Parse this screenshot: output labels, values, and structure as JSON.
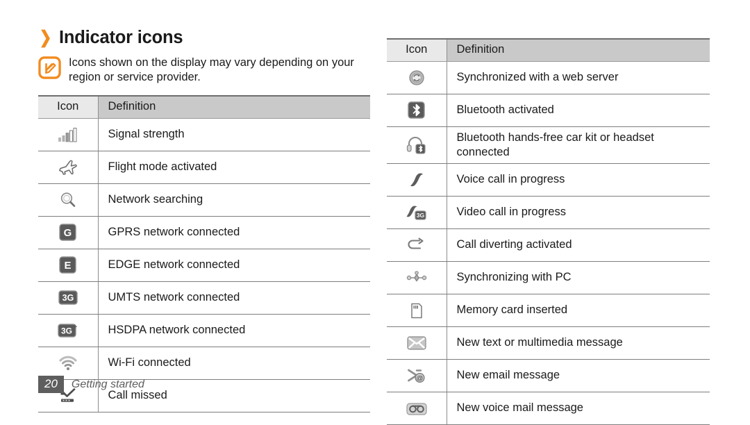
{
  "heading": {
    "chevron": "chevron-right-icon",
    "title": "Indicator icons"
  },
  "note": {
    "icon": "note-pencil-icon",
    "text": "Icons shown on the display may vary depending on your region or service provider."
  },
  "table_headers": {
    "icon": "Icon",
    "definition": "Definition"
  },
  "left_table": {
    "rows": [
      {
        "icon": "signal-strength-icon",
        "definition": "Signal strength"
      },
      {
        "icon": "flight-mode-icon",
        "definition": "Flight mode activated"
      },
      {
        "icon": "network-searching-icon",
        "definition": "Network searching"
      },
      {
        "icon": "gprs-badge-icon",
        "badge": "G",
        "definition": "GPRS network connected"
      },
      {
        "icon": "edge-badge-icon",
        "badge": "E",
        "definition": "EDGE network connected"
      },
      {
        "icon": "umts-badge-icon",
        "badge": "3G",
        "definition": "UMTS network connected"
      },
      {
        "icon": "hsdpa-badge-icon",
        "badge": "3G+",
        "definition": "HSDPA network connected"
      },
      {
        "icon": "wifi-connected-icon",
        "definition": "Wi-Fi connected"
      },
      {
        "icon": "call-missed-icon",
        "definition": "Call missed"
      }
    ]
  },
  "right_table": {
    "rows": [
      {
        "icon": "web-sync-icon",
        "definition": "Synchronized with a web server"
      },
      {
        "icon": "bluetooth-activated-icon",
        "definition": "Bluetooth activated"
      },
      {
        "icon": "bluetooth-headset-icon",
        "definition": "Bluetooth hands-free car kit or headset connected"
      },
      {
        "icon": "voice-call-icon",
        "definition": "Voice call in progress"
      },
      {
        "icon": "video-call-icon",
        "definition": "Video call in progress"
      },
      {
        "icon": "call-diverting-icon",
        "definition": "Call diverting activated"
      },
      {
        "icon": "pc-sync-icon",
        "definition": "Synchronizing with PC"
      },
      {
        "icon": "memory-card-icon",
        "definition": "Memory card inserted"
      },
      {
        "icon": "new-message-icon",
        "definition": "New text or multimedia message"
      },
      {
        "icon": "new-email-icon",
        "definition": "New email message"
      },
      {
        "icon": "new-voicemail-icon",
        "definition": "New voice mail message"
      }
    ]
  },
  "footer": {
    "page_number": "20",
    "section": "Getting started"
  },
  "colors": {
    "accent": "#f28b1e",
    "header_icon_bg": "#e9e9e9",
    "header_def_bg": "#c9c9c9",
    "rule": "#7d7d7d",
    "footer_gray": "#5e5e5e"
  }
}
